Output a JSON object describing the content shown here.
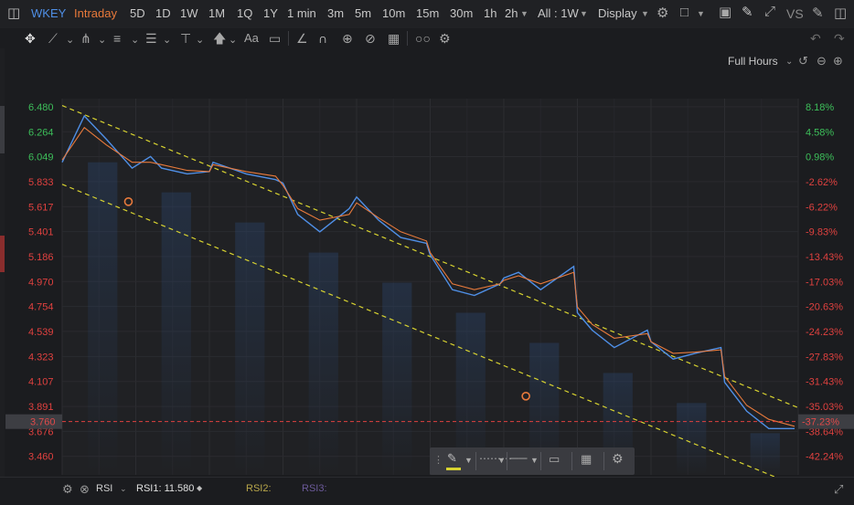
{
  "header": {
    "symbol": "WKEY",
    "mode": "Intraday",
    "periods": [
      "5D",
      "1D",
      "1W",
      "1M",
      "1Q",
      "1Y",
      "1 min",
      "3m",
      "5m",
      "10m",
      "15m",
      "30m",
      "1h",
      "2h"
    ],
    "range_selector": "All : 1W",
    "display_label": "Display",
    "vs_label": "VS"
  },
  "session_label": "Full Hours",
  "indicator": {
    "name": "RSI",
    "rsi1_label": "RSI1: 11.580",
    "rsi2_label": "RSI2:",
    "rsi3_label": "RSI3:"
  },
  "colors": {
    "background": "#1b1c1f",
    "plot_background": "#202124",
    "price_line": "#4f8fe6",
    "avg_line": "#e87a3c",
    "channel": "#d8d330",
    "up_text": "#3dbf5a",
    "down_text": "#e0413f",
    "active_period": "#e8793a"
  },
  "icons": {
    "crosshair": "crosshair-icon",
    "line": "trend-line-icon",
    "fork": "pitchfork-icon",
    "text": "text-icon",
    "magnet": "magnet-icon",
    "settings": "gear-icon"
  },
  "chart_data": {
    "type": "line",
    "title": "",
    "xlabel": "",
    "ylabel": "",
    "ylim": [
      3.3,
      6.55
    ],
    "y_ticks": [
      6.48,
      6.264,
      6.049,
      5.833,
      5.617,
      5.401,
      5.186,
      4.97,
      4.754,
      4.539,
      4.323,
      4.107,
      3.891,
      3.676,
      3.46
    ],
    "y_tick_labels": [
      "6.480",
      "6.264",
      "6.049",
      "5.833",
      "5.617",
      "5.401",
      "5.186",
      "4.970",
      "4.754",
      "4.539",
      "4.323",
      "4.107",
      "3.891",
      "3.676",
      "3.460"
    ],
    "pct_ticks": [
      "8.18%",
      "4.58%",
      "0.98%",
      "-2.62%",
      "-6.22%",
      "-9.83%",
      "-13.43%",
      "-17.03%",
      "-20.63%",
      "-24.23%",
      "-27.83%",
      "-31.43%",
      "-35.03%",
      "-38.64%",
      "-42.24%"
    ],
    "current_price": 3.76,
    "current_price_label": "3.760",
    "current_pct_label": "-37.23%",
    "sessions": 10,
    "x": [
      0.0,
      0.3,
      0.6,
      0.95,
      1.2,
      1.35,
      1.7,
      2.0,
      2.05,
      2.5,
      2.9,
      3.0,
      3.2,
      3.5,
      3.9,
      4.0,
      4.3,
      4.6,
      4.95,
      5.0,
      5.3,
      5.6,
      5.95,
      6.0,
      6.2,
      6.5,
      6.95,
      7.0,
      7.2,
      7.5,
      7.95,
      8.0,
      8.3,
      8.6,
      8.95,
      9.0,
      9.3,
      9.6,
      9.95
    ],
    "series": [
      {
        "name": "",
        "values": [
          6.0,
          6.4,
          6.2,
          5.95,
          6.05,
          5.95,
          5.9,
          5.92,
          6.0,
          5.9,
          5.85,
          5.82,
          5.55,
          5.4,
          5.6,
          5.7,
          5.5,
          5.35,
          5.3,
          5.2,
          4.9,
          4.85,
          4.95,
          5.0,
          5.05,
          4.9,
          5.1,
          4.7,
          4.55,
          4.4,
          4.55,
          4.45,
          4.3,
          4.35,
          4.4,
          4.1,
          3.85,
          3.7,
          3.7
        ]
      },
      {
        "name": "",
        "values": [
          6.02,
          6.3,
          6.15,
          6.0,
          6.0,
          5.98,
          5.93,
          5.92,
          5.98,
          5.92,
          5.88,
          5.8,
          5.6,
          5.5,
          5.55,
          5.65,
          5.52,
          5.4,
          5.32,
          5.22,
          4.95,
          4.9,
          4.95,
          4.98,
          5.02,
          4.95,
          5.05,
          4.75,
          4.6,
          4.48,
          4.52,
          4.45,
          4.35,
          4.36,
          4.38,
          4.15,
          3.9,
          3.78,
          3.72
        ]
      }
    ],
    "channel": {
      "upper": [
        [
          0.0,
          6.49
        ],
        [
          10.0,
          3.88
        ]
      ],
      "lower": [
        [
          0.0,
          5.81
        ],
        [
          10.0,
          3.2
        ]
      ]
    },
    "grid": true
  }
}
